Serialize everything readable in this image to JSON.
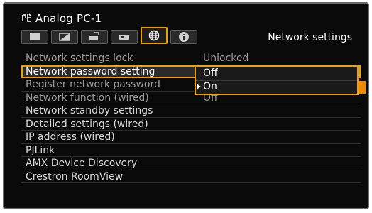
{
  "header": {
    "source_icon": "input-source-icon",
    "source_label": "Analog PC-1",
    "section_title": "Network settings"
  },
  "tabs": [
    {
      "name": "display-tab",
      "icon": "screen-icon"
    },
    {
      "name": "picture-tab",
      "icon": "picture-adjust-icon"
    },
    {
      "name": "install-tab",
      "icon": "projector-install-icon"
    },
    {
      "name": "settings-tab",
      "icon": "settings-icon"
    },
    {
      "name": "network-tab",
      "icon": "globe-icon",
      "active": true
    },
    {
      "name": "info-tab",
      "icon": "info-icon"
    }
  ],
  "menu": [
    {
      "label": "Network settings lock",
      "value": "Unlocked"
    },
    {
      "label": "Network password setting",
      "value": "",
      "selected": true
    },
    {
      "label": "Register network password",
      "value": ""
    },
    {
      "label": "Network function (wired)",
      "value": "Off"
    },
    {
      "label": "Network standby settings",
      "value": ""
    },
    {
      "label": "Detailed settings (wired)",
      "value": ""
    },
    {
      "label": "IP address (wired)",
      "value": ""
    },
    {
      "label": "PJLink",
      "value": ""
    },
    {
      "label": "AMX Device Discovery",
      "value": ""
    },
    {
      "label": "Crestron RoomView",
      "value": ""
    }
  ],
  "dropdown": {
    "options": [
      "Off",
      "On"
    ]
  },
  "colors": {
    "accent": "#f0a000",
    "background": "#0a0a0a",
    "text": "#ffffff",
    "text_dim": "#9a9a9a"
  }
}
